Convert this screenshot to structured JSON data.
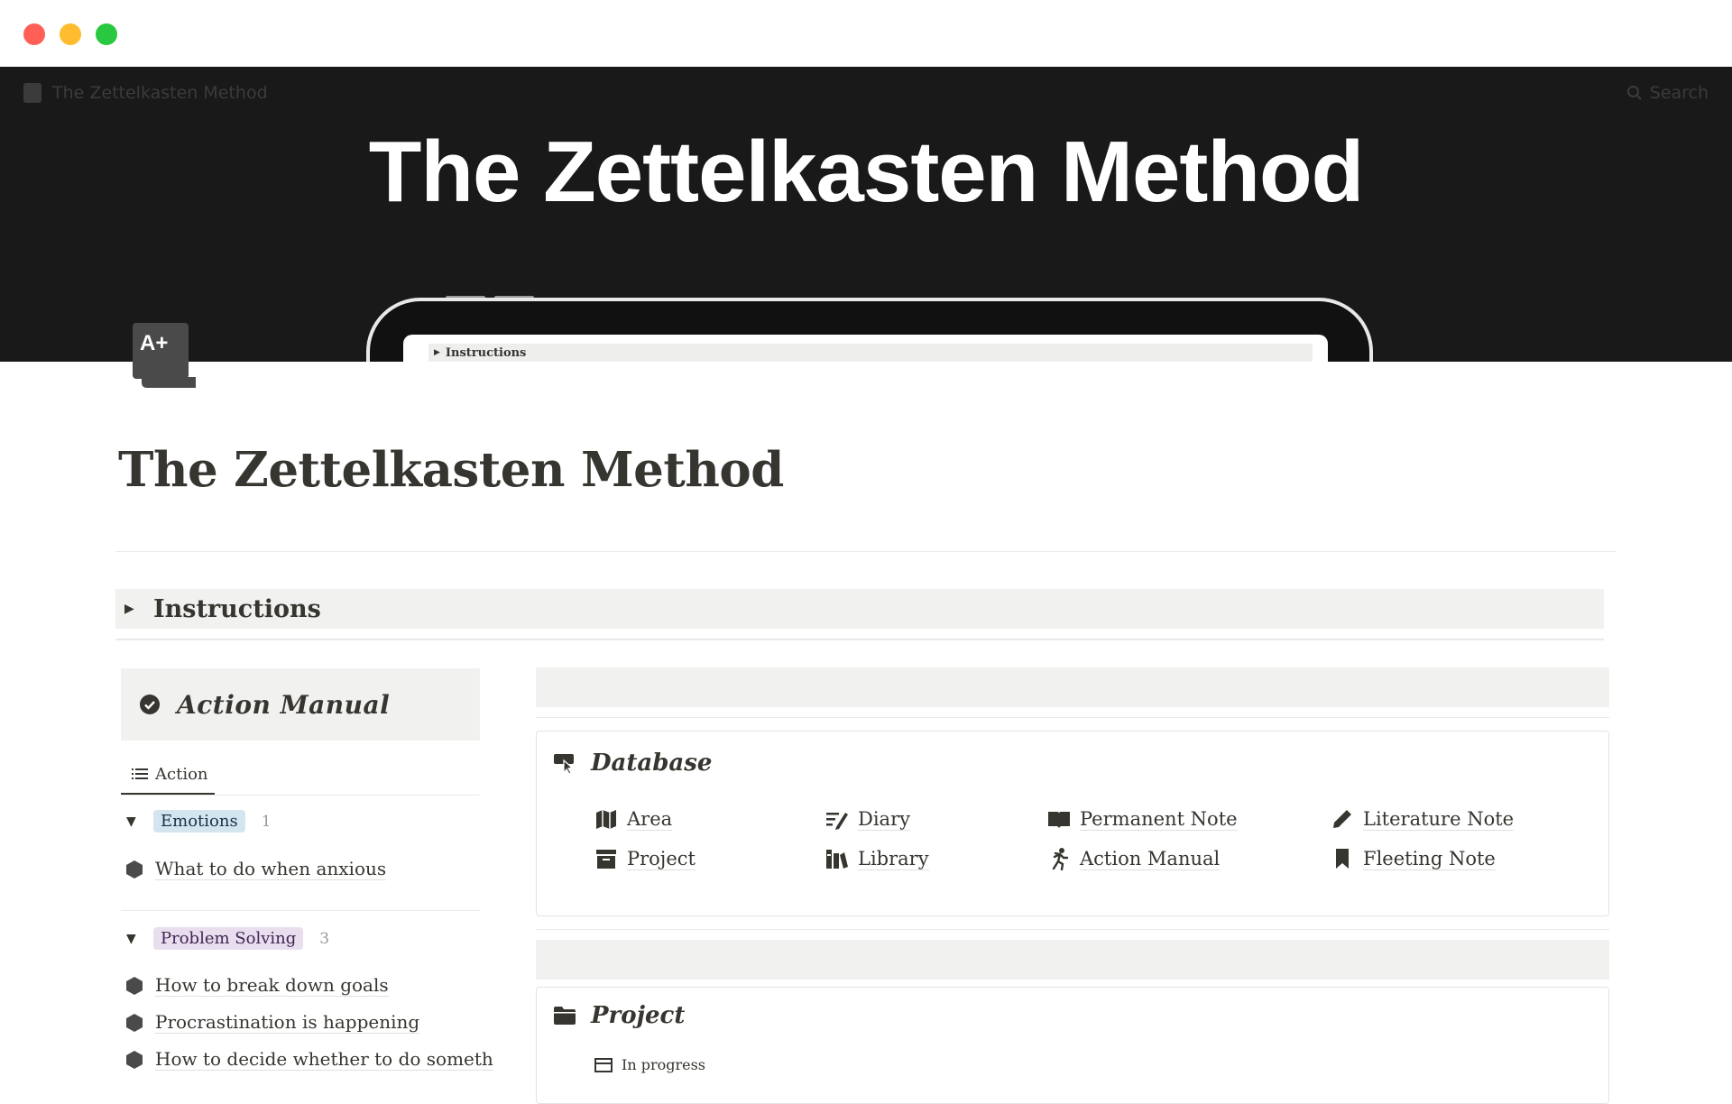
{
  "window": {
    "controls": [
      "close",
      "minimize",
      "maximize"
    ]
  },
  "topbar": {
    "page_name": "The Zettelkasten Method",
    "search_label": "Search"
  },
  "cover": {
    "title": "The Zettelkasten Method",
    "screen_toggle": "Instructions"
  },
  "page": {
    "title": "The Zettelkasten Method",
    "instructions_label": "Instructions"
  },
  "action_manual": {
    "title": "Action Manual",
    "tab_label": "Action",
    "groups": [
      {
        "tag": "Emotions",
        "count": "1",
        "items": [
          "What to do when anxious"
        ]
      },
      {
        "tag": "Problem Solving",
        "count": "3",
        "items": [
          "How to break down goals",
          "Procrastination is happening",
          "How to decide whether to do someth"
        ]
      }
    ]
  },
  "database": {
    "title": "Database",
    "links": [
      {
        "label": "Area",
        "icon": "map-icon"
      },
      {
        "label": "Diary",
        "icon": "write-icon"
      },
      {
        "label": "Permanent Note",
        "icon": "book-icon"
      },
      {
        "label": "Literature Note",
        "icon": "pencil-icon"
      },
      {
        "label": "Project",
        "icon": "archive-icon"
      },
      {
        "label": "Library",
        "icon": "library-icon"
      },
      {
        "label": "Action Manual",
        "icon": "runner-icon"
      },
      {
        "label": "Fleeting Note",
        "icon": "bookmark-icon"
      }
    ]
  },
  "project": {
    "title": "Project",
    "view_label": "In progress"
  },
  "colors": {
    "cover_bg": "#191919",
    "text": "#37352f",
    "callout_bg": "#f1f1ef",
    "tag_blue": "#d3e5ef",
    "tag_purple": "#e8deee"
  }
}
